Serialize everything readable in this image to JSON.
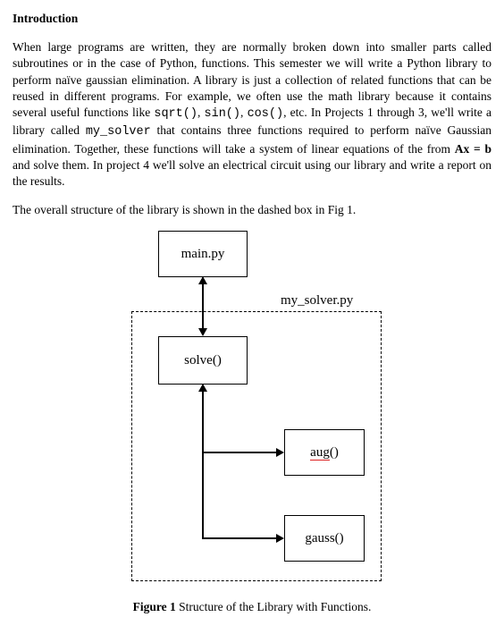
{
  "heading": "Introduction",
  "para1_a": "When large programs are written, they are normally broken down into smaller parts called subroutines or in the case of Python, functions. This semester we will write a Python library to perform naïve gaussian elimination. A library is just a collection of related functions that can be reused in different programs. For example, we often use the math library because it contains several useful functions like ",
  "code_sqrt": "sqrt()",
  "sep1": ", ",
  "code_sin": "sin()",
  "sep2": ", ",
  "code_cos": "cos()",
  "para1_b": ", etc. In Projects 1 through 3, we'll write a library called ",
  "code_lib": "my_solver",
  "para1_c": " that contains three functions required to perform naïve Gaussian elimination. Together, these functions will take a system of linear equations of the from ",
  "eqn": "Ax = b",
  "para1_d": " and solve them. In project 4 we'll solve an electrical circuit using our library and write a report on the results.",
  "para2": "The overall structure of the library is shown in the dashed box in Fig 1.",
  "diagram": {
    "main": "main.py",
    "module": "my_solver.py",
    "solve": "solve()",
    "aug_u": "aug",
    "aug_paren": "()",
    "gauss": "gauss()"
  },
  "caption_b": "Figure 1",
  "caption_rest": " Structure of the Library with Functions."
}
